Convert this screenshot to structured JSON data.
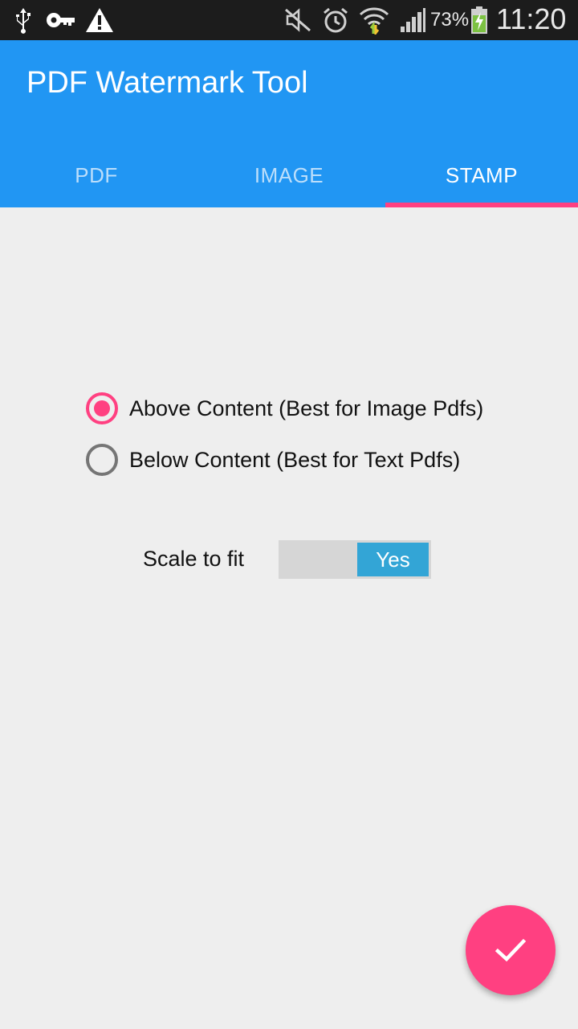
{
  "status_bar": {
    "icons": [
      "usb-icon",
      "key-icon",
      "warning-icon",
      "mute-icon",
      "alarm-icon",
      "wifi-icon",
      "signal-icon",
      "battery-charging-icon"
    ],
    "battery_percent": "73%",
    "time": "11:20"
  },
  "app_bar": {
    "title": "PDF Watermark Tool",
    "tabs": [
      {
        "label": "PDF"
      },
      {
        "label": "IMAGE"
      },
      {
        "label": "STAMP"
      }
    ],
    "active_tab": "STAMP"
  },
  "stamp": {
    "options": [
      {
        "label": "Above Content (Best for Image Pdfs)",
        "checked": true
      },
      {
        "label": "Below Content (Best for Text Pdfs)",
        "checked": false
      }
    ],
    "scale_label": "Scale to fit",
    "scale_value": "Yes"
  },
  "fab": {
    "icon": "check-icon"
  },
  "colors": {
    "primary": "#2196F3",
    "accent": "#FF4081",
    "toggle_on": "#33A5D6",
    "background": "#EEEEEE"
  }
}
